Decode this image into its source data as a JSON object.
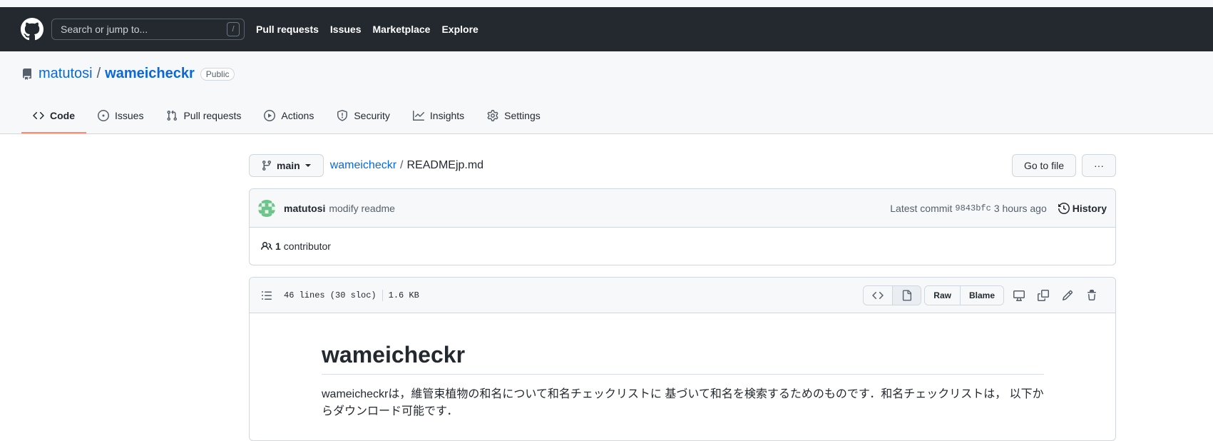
{
  "header": {
    "search_placeholder": "Search or jump to...",
    "search_shortcut": "/",
    "nav": [
      "Pull requests",
      "Issues",
      "Marketplace",
      "Explore"
    ]
  },
  "repo": {
    "owner": "matutosi",
    "separator": "/",
    "name": "wameicheckr",
    "visibility": "Public"
  },
  "tabs": [
    {
      "label": "Code",
      "icon": "code-icon",
      "active": true
    },
    {
      "label": "Issues",
      "icon": "issue-icon"
    },
    {
      "label": "Pull requests",
      "icon": "pull-request-icon"
    },
    {
      "label": "Actions",
      "icon": "play-icon"
    },
    {
      "label": "Security",
      "icon": "shield-icon"
    },
    {
      "label": "Insights",
      "icon": "graph-icon"
    },
    {
      "label": "Settings",
      "icon": "gear-icon"
    }
  ],
  "pathbar": {
    "branch": "main",
    "root": "wameicheckr",
    "separator": "/",
    "file": "READMEjp.md",
    "go_to_file": "Go to file",
    "more": "···"
  },
  "commit": {
    "author": "matutosi",
    "message": "modify readme",
    "latest_label": "Latest commit",
    "sha": "9843bfc",
    "time": "3 hours ago",
    "history": "History"
  },
  "contributors": {
    "count": "1",
    "label": "contributor"
  },
  "file": {
    "lines": "46 lines (30 sloc)",
    "size": "1.6 KB",
    "raw": "Raw",
    "blame": "Blame"
  },
  "readme": {
    "heading": "wameicheckr",
    "paragraph": "wameicheckrは，維管束植物の和名について和名チェックリストに 基づいて和名を検索するためのものです．和名チェックリストは， 以下からダウンロード可能です．"
  },
  "colors": {
    "header_bg": "#24292f",
    "link": "#0969da",
    "active_tab_underline": "#fd8c73"
  }
}
